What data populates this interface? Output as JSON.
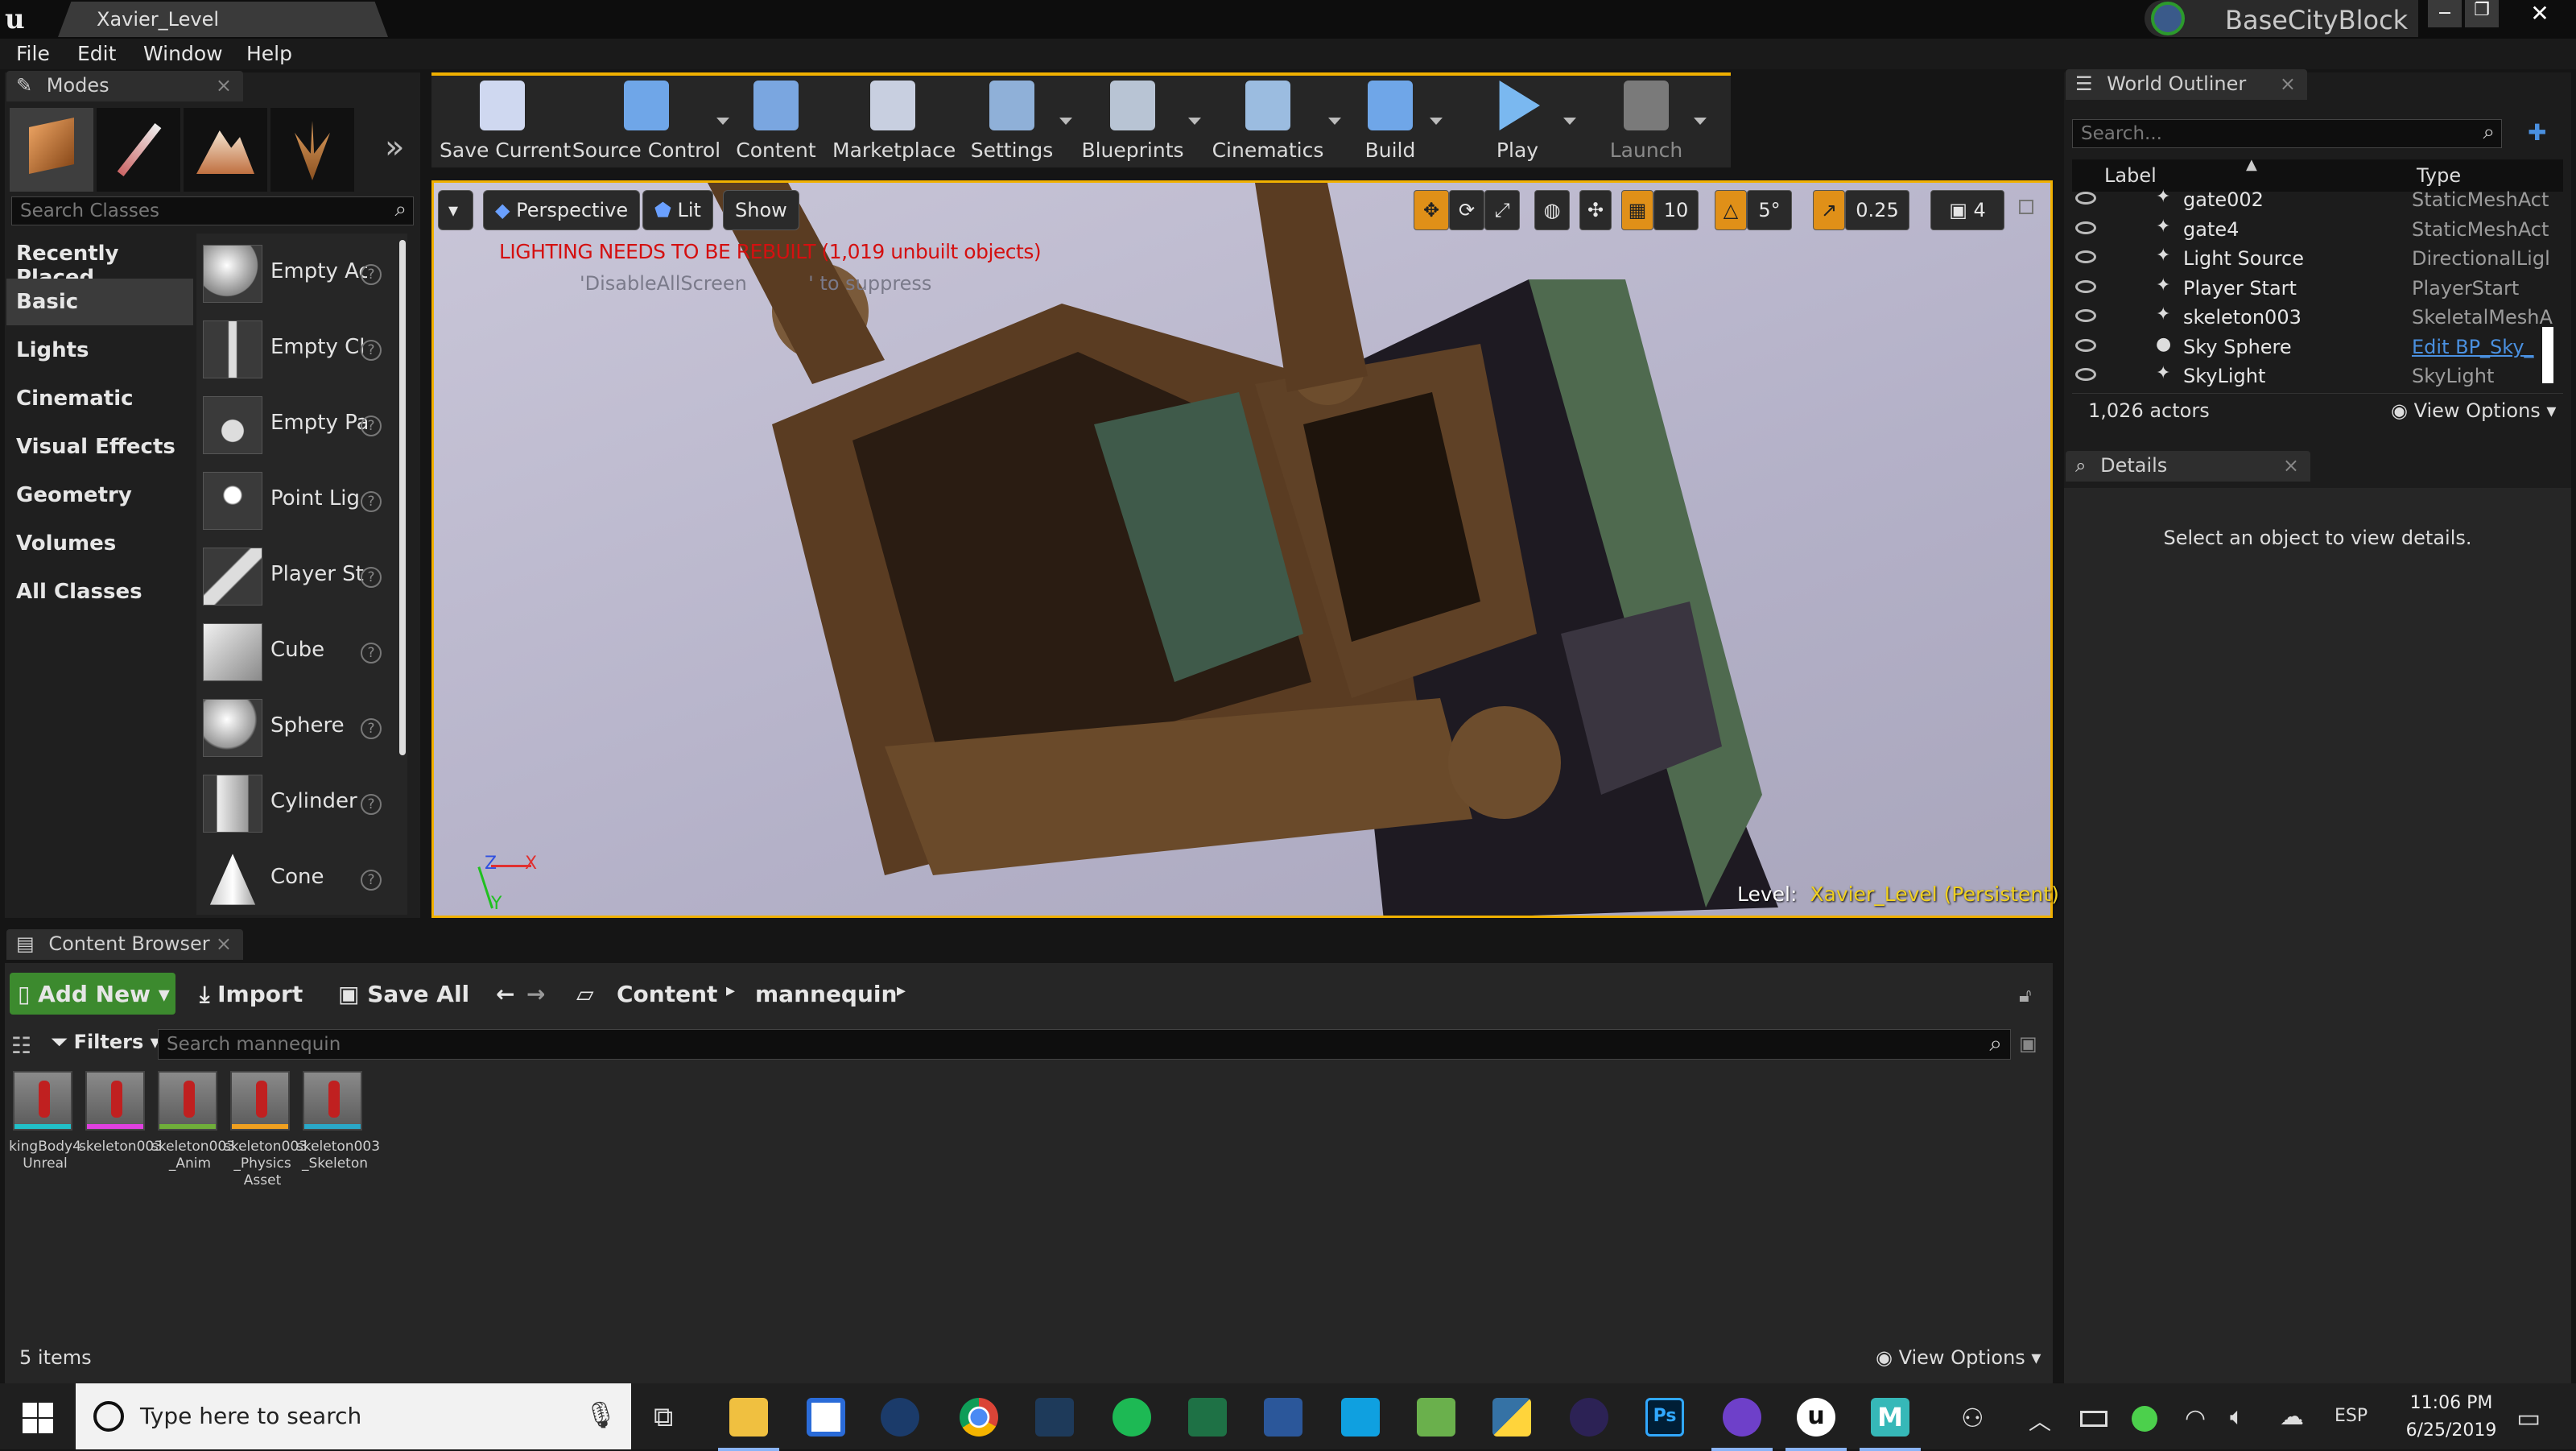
{
  "window": {
    "tab_title": "Xavier_Level",
    "project": "BaseCityBlock"
  },
  "menu": [
    "File",
    "Edit",
    "Window",
    "Help"
  ],
  "modes": {
    "tab": "Modes",
    "search_placeholder": "Search Classes",
    "categories": [
      "Recently Placed",
      "Basic",
      "Lights",
      "Cinematic",
      "Visual Effects",
      "Geometry",
      "Volumes",
      "All Classes"
    ],
    "selected_category": "Basic",
    "actors": [
      "Empty Ac",
      "Empty Cl",
      "Empty Pa",
      "Point Lig",
      "Player St",
      "Cube",
      "Sphere",
      "Cylinder",
      "Cone"
    ]
  },
  "toolbar": [
    {
      "label": "Save Current",
      "icon": "save-icon",
      "drop": false
    },
    {
      "label": "Source Control",
      "icon": "source-control-icon",
      "drop": true
    },
    {
      "label": "Content",
      "icon": "content-icon",
      "drop": false
    },
    {
      "label": "Marketplace",
      "icon": "marketplace-icon",
      "drop": false
    },
    {
      "label": "Settings",
      "icon": "settings-icon",
      "drop": true
    },
    {
      "label": "Blueprints",
      "icon": "blueprints-icon",
      "drop": true
    },
    {
      "label": "Cinematics",
      "icon": "cinematics-icon",
      "drop": true
    },
    {
      "label": "Build",
      "icon": "build-icon",
      "drop": true
    },
    {
      "label": "Play",
      "icon": "play-icon",
      "drop": true
    },
    {
      "label": "Launch",
      "icon": "launch-icon",
      "drop": true
    }
  ],
  "viewport": {
    "perspective": "Perspective",
    "lit": "Lit",
    "show": "Show",
    "warning": "LIGHTING NEEDS TO BE REBUILT (1,019 unbuilt objects)",
    "suppress": "'DisableAllScreen          ' to suppress",
    "grid_snap": "10",
    "rot_snap": "5°",
    "scale_snap": "0.25",
    "cam_speed": "4",
    "level_label": "Level:",
    "level_name": "Xavier_Level (Persistent)",
    "axis_z": "Z",
    "axis_x": "X",
    "axis_y": "Y"
  },
  "outliner": {
    "tab": "World Outliner",
    "search_placeholder": "Search...",
    "col_label": "Label",
    "col_type": "Type",
    "rows": [
      {
        "label": "gate002",
        "type": "StaticMeshAct"
      },
      {
        "label": "gate4",
        "type": "StaticMeshAct"
      },
      {
        "label": "Light Source",
        "type": "DirectionalLigl"
      },
      {
        "label": "Player Start",
        "type": "PlayerStart"
      },
      {
        "label": "skeleton003",
        "type": "SkeletalMeshA"
      },
      {
        "label": "Sky Sphere",
        "type": "Edit BP_Sky_"
      },
      {
        "label": "SkyLight",
        "type": "SkyLight"
      }
    ],
    "count": "1,026 actors",
    "view_options": "View Options"
  },
  "details": {
    "tab": "Details",
    "empty_text": "Select an object to view details."
  },
  "content_browser": {
    "tab": "Content Browser",
    "add_new": "Add New",
    "import": "Import",
    "save_all": "Save All",
    "path": [
      "Content",
      "mannequin"
    ],
    "filters": "Filters",
    "search_placeholder": "Search mannequin",
    "assets": [
      {
        "name": "kingBody4\nUnreal",
        "color": "#22c0c8"
      },
      {
        "name": "skeleton003",
        "color": "#e040e0"
      },
      {
        "name": "skeleton003\n_Anim",
        "color": "#6fae3a"
      },
      {
        "name": "skeleton003\n_Physics\nAsset",
        "color": "#f0a020"
      },
      {
        "name": "skeleton003\n_Skeleton",
        "color": "#2aa8c8"
      }
    ],
    "count": "5 items",
    "view_options": "View Options"
  },
  "taskbar": {
    "search_placeholder": "Type here to search",
    "lang": "ESP",
    "time": "11:06 PM",
    "date": "6/25/2019"
  }
}
